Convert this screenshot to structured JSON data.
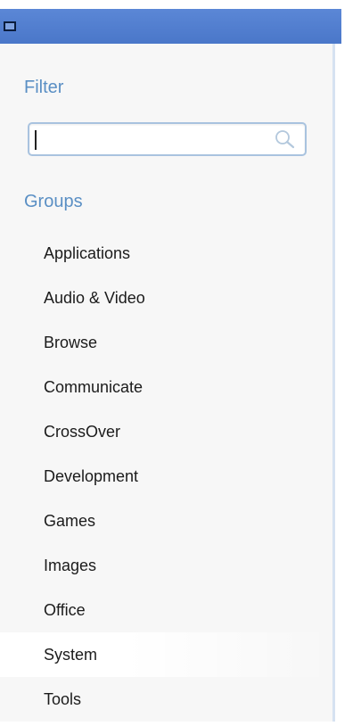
{
  "filter": {
    "title": "Filter",
    "input_value": "",
    "placeholder": ""
  },
  "groups": {
    "title": "Groups",
    "items": [
      {
        "label": "Applications"
      },
      {
        "label": "Audio & Video"
      },
      {
        "label": "Browse"
      },
      {
        "label": "Communicate"
      },
      {
        "label": "CrossOver"
      },
      {
        "label": "Development"
      },
      {
        "label": "Games"
      },
      {
        "label": "Images"
      },
      {
        "label": "Office"
      },
      {
        "label": "System"
      },
      {
        "label": "Tools"
      }
    ]
  },
  "icons": {
    "window": "window-icon",
    "search": "search-icon"
  },
  "colors": {
    "titlebar": "#4f7fcf",
    "section_title": "#5a8fc4",
    "panel": "#f7f7f7",
    "search_border": "#a9c3df"
  }
}
